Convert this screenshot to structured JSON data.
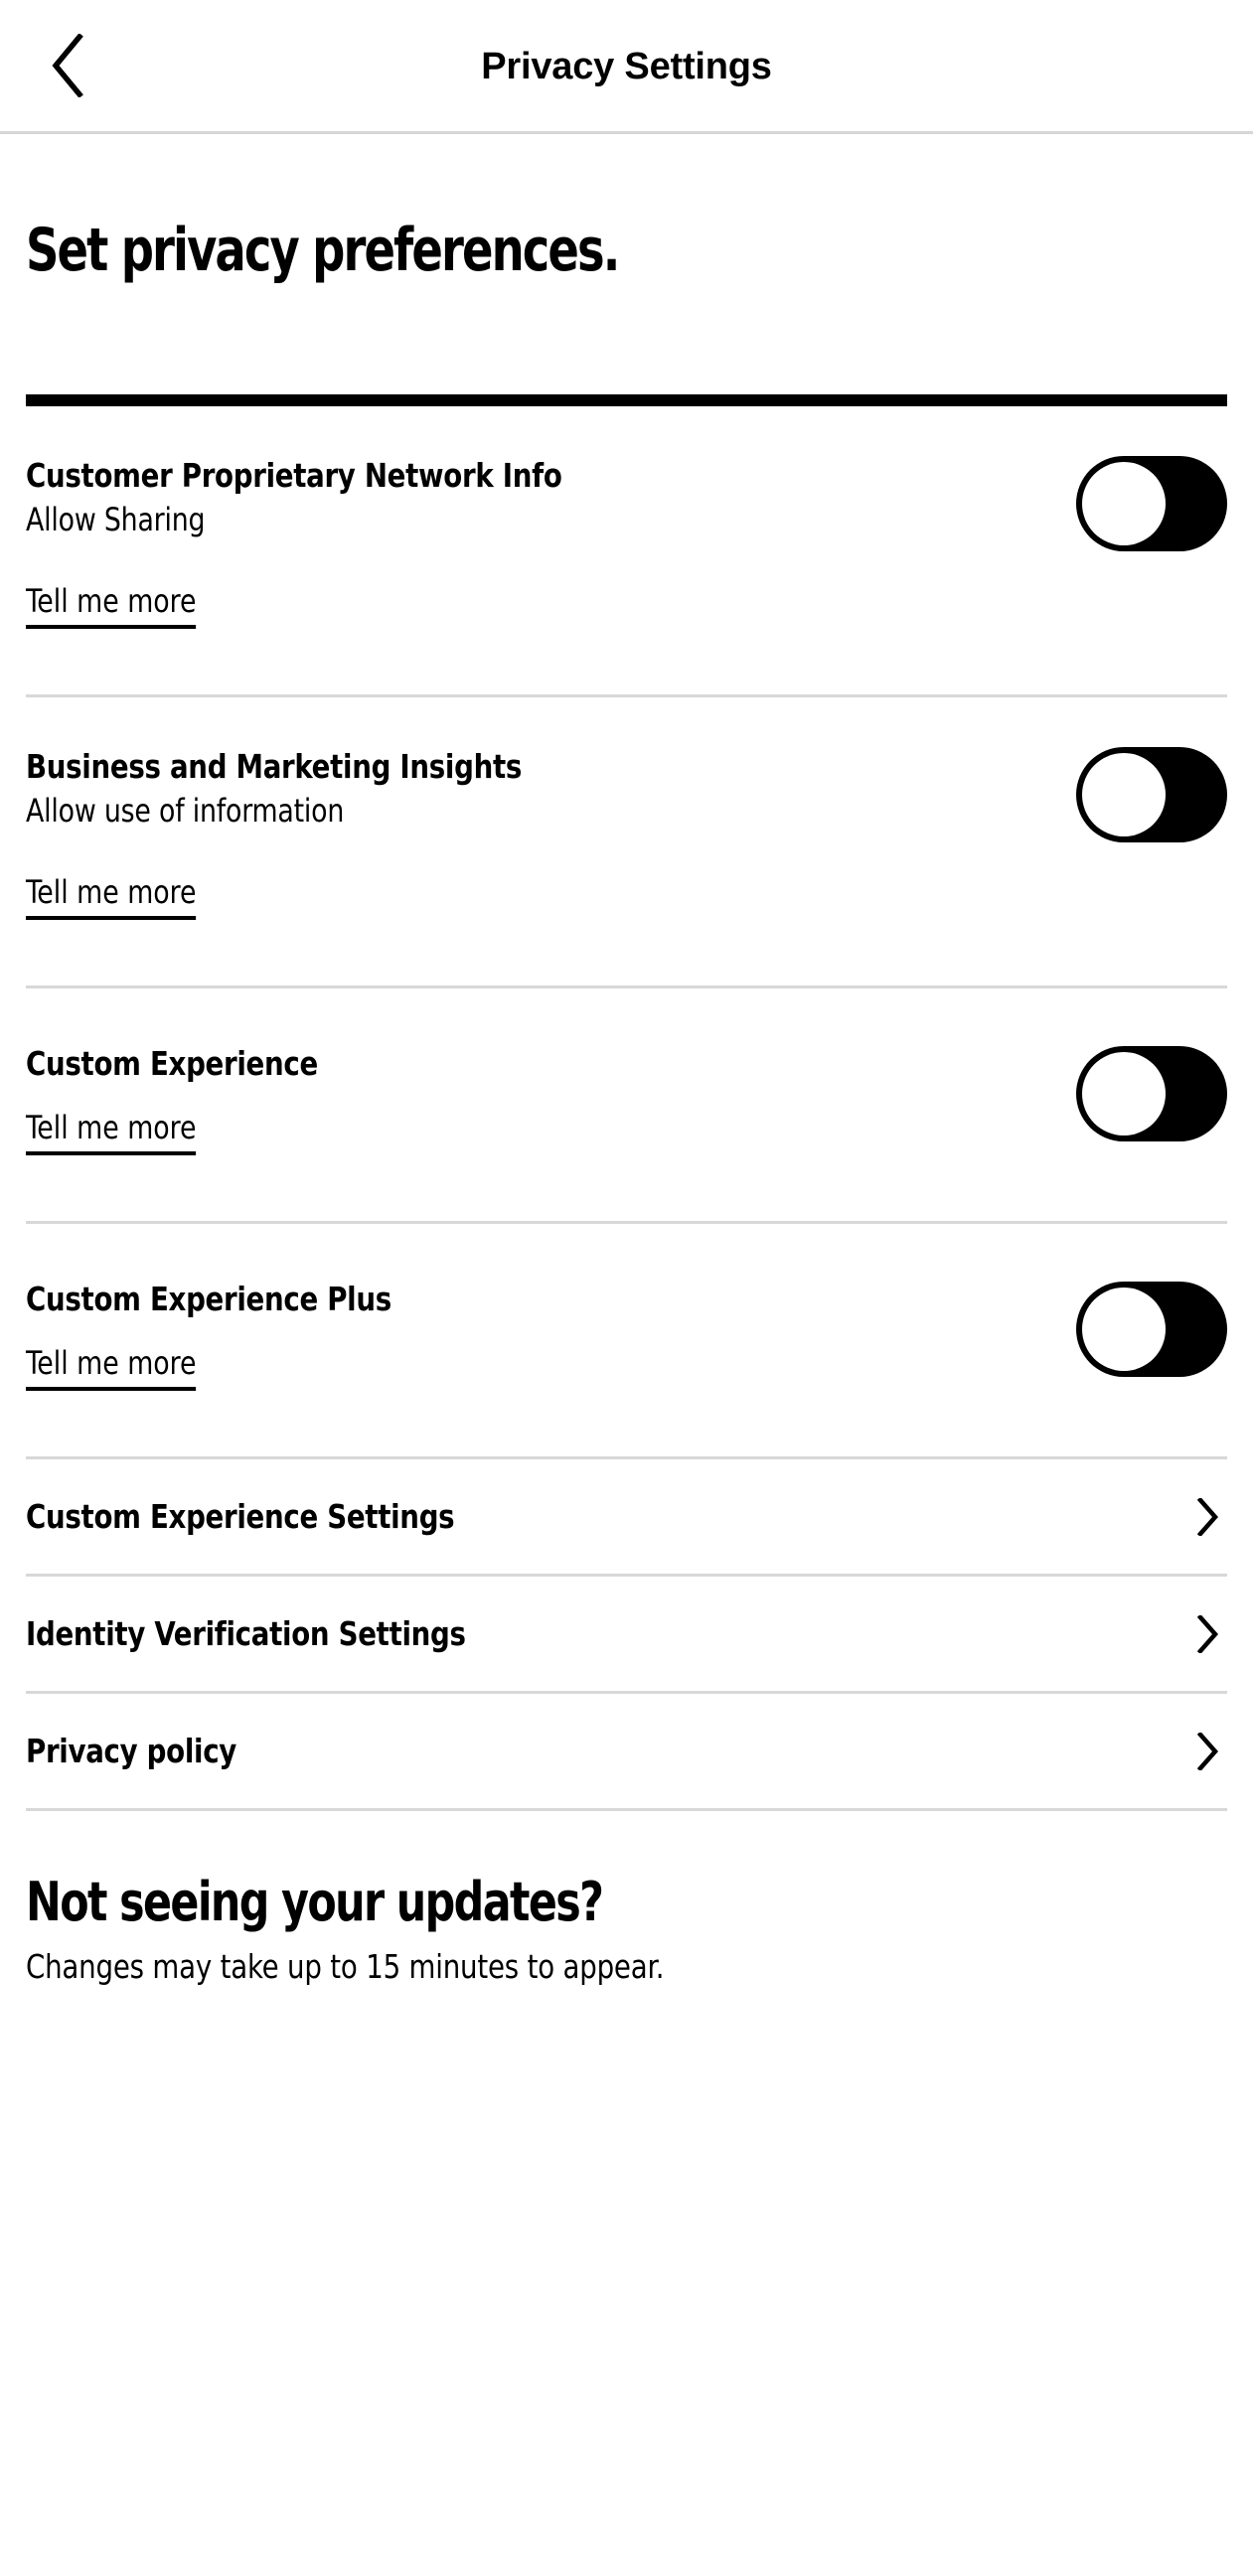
{
  "header": {
    "back_icon": "chevron-left-icon",
    "title": "Privacy Settings"
  },
  "page": {
    "heading": "Set privacy preferences."
  },
  "toggle_rows": [
    {
      "title": "Customer Proprietary Network Info",
      "subtitle": "Allow Sharing",
      "link": "Tell me more",
      "toggle_state": "off"
    },
    {
      "title": "Business and Marketing Insights",
      "subtitle": "Allow use of information",
      "link": "Tell me more",
      "toggle_state": "off"
    },
    {
      "title": "Custom Experience",
      "subtitle": "",
      "link": "Tell me more",
      "toggle_state": "off"
    },
    {
      "title": "Custom Experience Plus",
      "subtitle": "",
      "link": "Tell me more",
      "toggle_state": "off"
    }
  ],
  "nav_rows": [
    {
      "label": "Custom Experience Settings",
      "icon": "chevron-right-icon"
    },
    {
      "label": "Identity Verification Settings",
      "icon": "chevron-right-icon"
    },
    {
      "label": "Privacy policy",
      "icon": "chevron-right-icon"
    }
  ],
  "footer": {
    "heading": "Not seeing your updates?",
    "subtitle": "Changes may take up to 15 minutes to appear."
  },
  "colors": {
    "accent": "#000000",
    "divider": "#d8d8d8",
    "background": "#ffffff"
  }
}
